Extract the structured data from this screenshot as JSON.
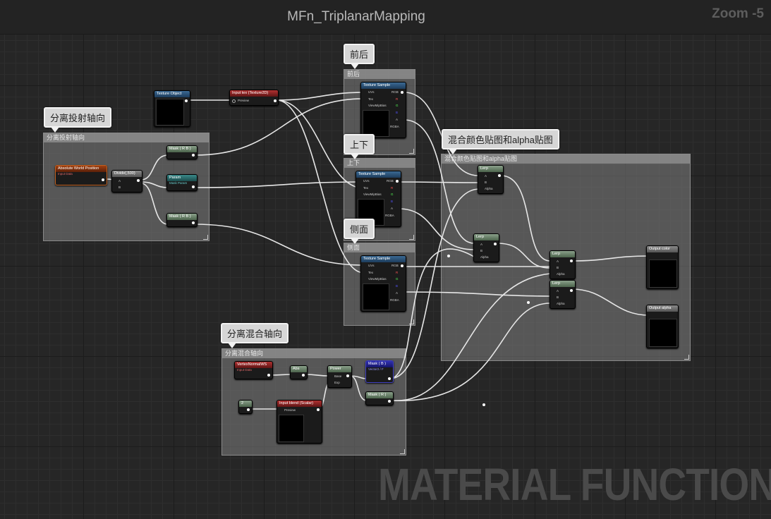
{
  "title": "MFn_TriplanarMapping",
  "zoom": "Zoom -5",
  "watermark": "MATERIAL FUNCTION",
  "bubbles": {
    "fen_li_tou_she": "分离投射轴向",
    "qian_hou": "前后",
    "shang_xia": "上下",
    "ce_mian": "侧面",
    "hun_he_yan_se": "混合颜色贴图和alpha贴图",
    "fen_li_hun_he": "分离混合轴向"
  },
  "comments": {
    "fen_li_tou_she": "分离投射轴向",
    "qian_hou": "前后",
    "shang_xia": "上下",
    "ce_mian": "侧面",
    "hun_he_yan_se": "混合颜色贴图和alpha贴图",
    "fen_li_hun_he": "分离混合轴向"
  },
  "nodes": {
    "texture_object": "Texture Object",
    "input_tex": "Input tex (Texture2D)",
    "input_tex_pin": "Preview",
    "absolute_world_position": "Absolute World Position",
    "input_data": "Input Data",
    "divide": "Divide(,500)",
    "pin_a": "A",
    "pin_b": "B",
    "mask_rb_top": "Mask ( R B )",
    "param": "Param",
    "param_sub": "Mask Param",
    "mask_rb_bottom": "Mask ( R B )",
    "texture_sample": "Texture Sample",
    "ts_uvs": "UVs",
    "ts_tex": "Tex",
    "ts_viewmip": "ViewMipBias",
    "ts_rgb": "RGB",
    "ts_r": "R",
    "ts_g": "G",
    "ts_b": "B",
    "ts_a": "A",
    "ts_rgba": "RGBA",
    "lerp": "Lerp",
    "lerp_alpha": "Alpha",
    "output_color": "Output color",
    "output_alpha": "Output alpha",
    "vertex_normal": "VertexNormalWS",
    "abs": "Abs",
    "power": "Power",
    "power_base": "Base",
    "power_exp": "Exp",
    "mask_b": "Mask ( B )",
    "mask_b_sub": "Vector2 / F",
    "mask_r": "Mask ( R )",
    "const_val": "2",
    "input_blend": "Input blend (Scalar)",
    "input_blend_pin": "Preview"
  }
}
